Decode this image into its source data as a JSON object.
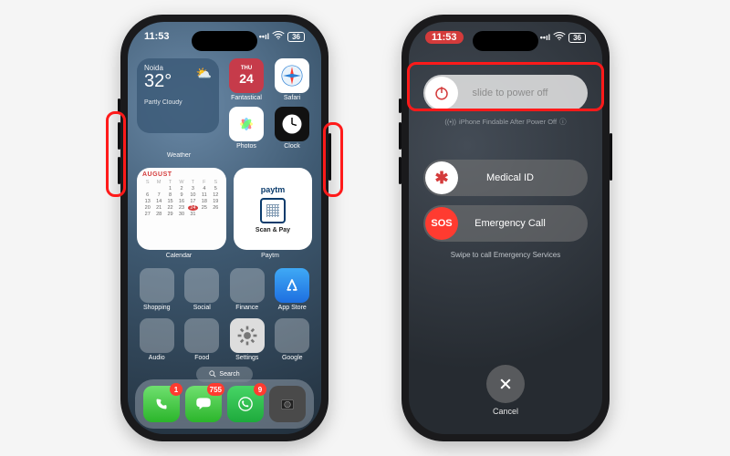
{
  "statusbar": {
    "time": "11:53",
    "battery": "36"
  },
  "weather": {
    "city": "Noida",
    "temp": "32°",
    "condition": "Partly Cloudy",
    "label": "Weather"
  },
  "top_apps": {
    "fantastical": "Fantastical",
    "safari": "Safari",
    "photos": "Photos",
    "clock": "Clock"
  },
  "calendar": {
    "month": "AUGUST",
    "label": "Calendar",
    "today": "24"
  },
  "paytm": {
    "brand": "paytm",
    "caption": "Scan & Pay",
    "label": "Paytm"
  },
  "grid": {
    "shopping": "Shopping",
    "social": "Social",
    "finance": "Finance",
    "appstore": "App Store",
    "audio": "Audio",
    "food": "Food",
    "settings": "Settings",
    "google": "Google"
  },
  "search": "Search",
  "dock_badges": {
    "phone": "1",
    "messages": "755",
    "whatsapp": "9"
  },
  "poweroff": {
    "slide": "slide to power off",
    "findable": "iPhone Findable After Power Off",
    "medical": "Medical ID",
    "sos_knob": "SOS",
    "sos": "Emergency Call",
    "swipe_hint": "Swipe to call Emergency Services",
    "cancel": "Cancel"
  }
}
